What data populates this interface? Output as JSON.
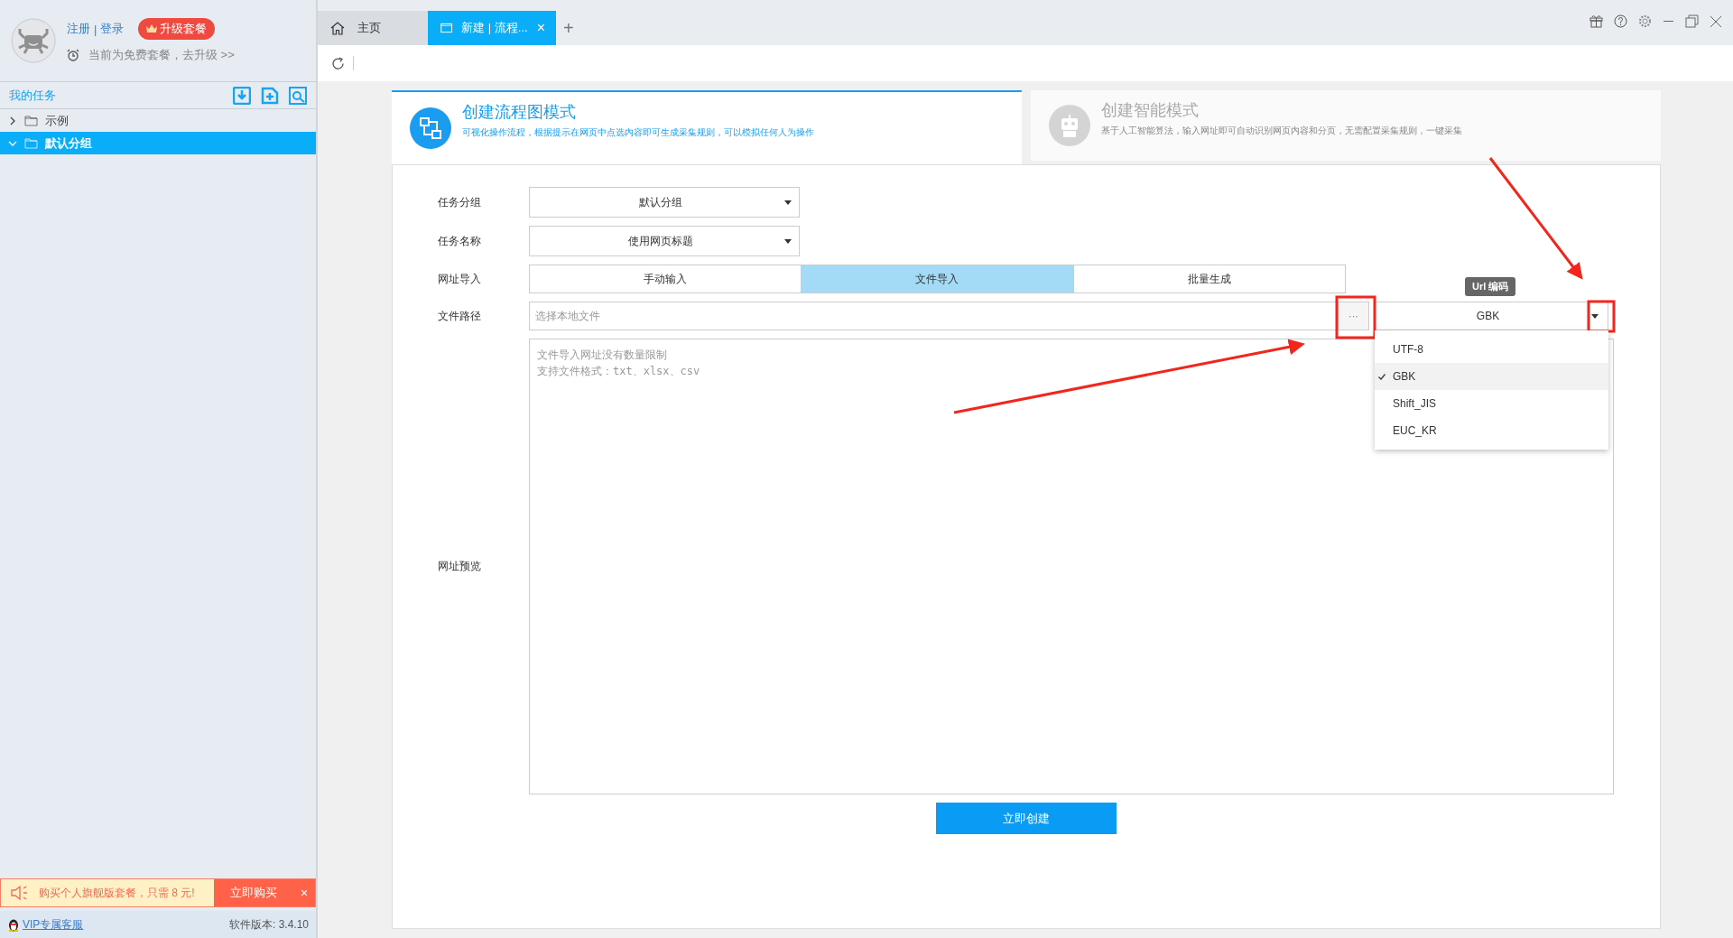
{
  "user": {
    "register": "注册",
    "separator": "|",
    "login": "登录",
    "upgrade_badge": "升级套餐",
    "plan_notice": "当前为免费套餐，去升级 >>"
  },
  "tasks": {
    "title": "我的任务",
    "groups": [
      {
        "label": "示例",
        "expanded": false,
        "selected": false
      },
      {
        "label": "默认分组",
        "expanded": true,
        "selected": true
      }
    ]
  },
  "promo": {
    "message": "购买个人旗舰版套餐，只需 8 元!",
    "button": "立即购买",
    "close": "×"
  },
  "footer": {
    "support_link": "VIP专属客服",
    "version": "软件版本: 3.4.10"
  },
  "tabs": [
    {
      "label": "主页",
      "kind": "home",
      "selected": false,
      "closable": false
    },
    {
      "label": "新建 | 流程...",
      "kind": "page",
      "selected": true,
      "closable": true
    }
  ],
  "tab_close": "×",
  "new_tab": "+",
  "modes": [
    {
      "kind": "flow",
      "title": "创建流程图模式",
      "description": "可视化操作流程，根据提示在网页中点选内容即可生成采集规则，可以模拟任何人为操作",
      "selected": true
    },
    {
      "kind": "robot",
      "title": "创建智能模式",
      "description": "基于人工智能算法，输入网址即可自动识别网页内容和分页，无需配置采集规则，一键采集",
      "selected": false
    }
  ],
  "form": {
    "group": {
      "label": "任务分组",
      "value": "默认分组"
    },
    "name": {
      "label": "任务名称",
      "value": "使用网页标题"
    },
    "url_import": {
      "label": "网址导入",
      "options": [
        {
          "label": "手动输入",
          "selected": false
        },
        {
          "label": "文件导入",
          "selected": true
        },
        {
          "label": "批量生成",
          "selected": false
        }
      ]
    },
    "file_path": {
      "label": "文件路径",
      "placeholder": "选择本地文件",
      "browse": "···"
    },
    "encoding": {
      "tooltip": "Url 编码",
      "value": "GBK",
      "expanded": true,
      "options": [
        {
          "label": "UTF-8",
          "selected": false
        },
        {
          "label": "GBK",
          "selected": true
        },
        {
          "label": "Shift_JIS",
          "selected": false
        },
        {
          "label": "EUC_KR",
          "selected": false
        }
      ]
    },
    "preview": {
      "label": "网址预览",
      "placeholder_lines": [
        "文件导入网址没有数量限制",
        "支持文件格式：txt、xlsx、csv"
      ]
    },
    "create_button": "立即创建"
  }
}
